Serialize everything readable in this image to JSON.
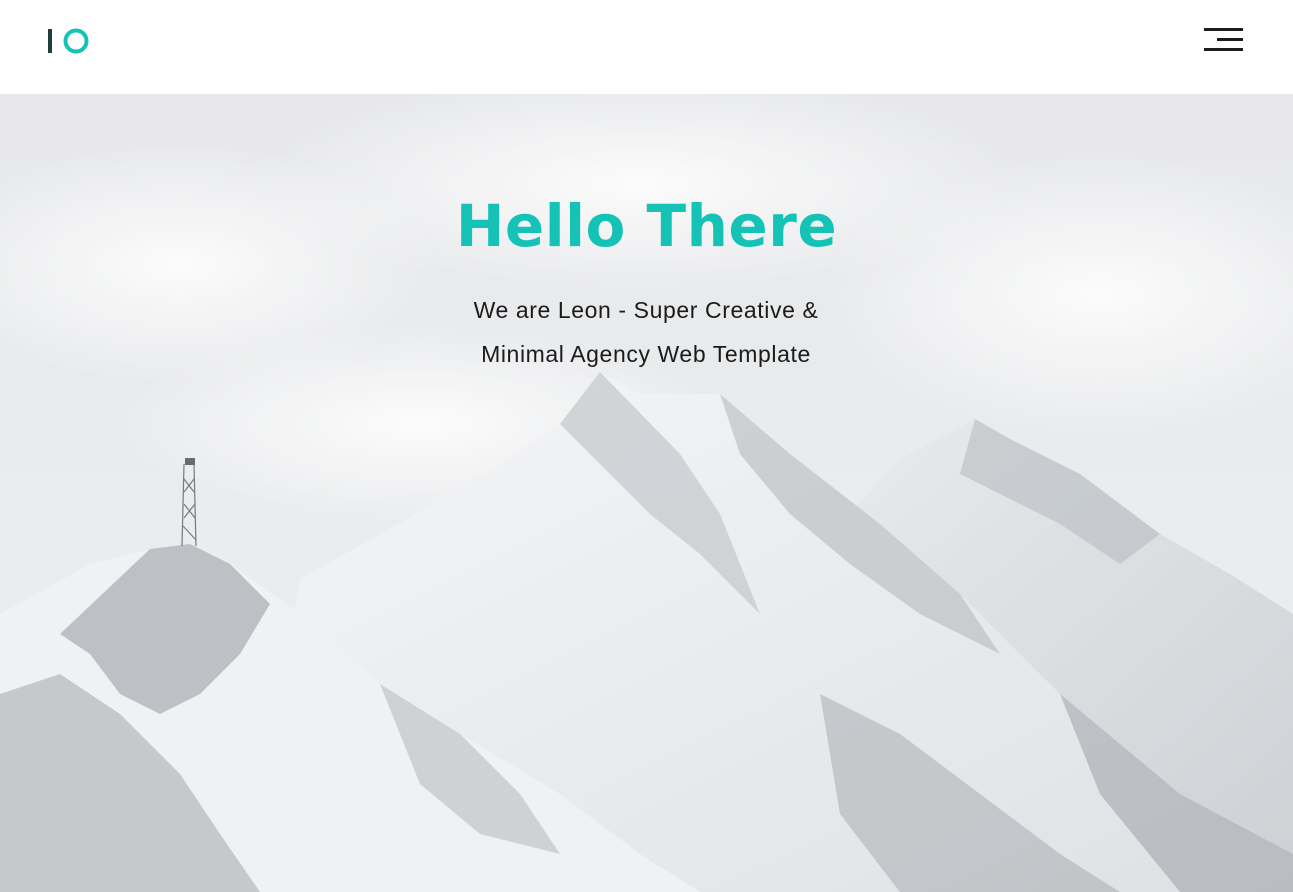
{
  "brand": {
    "logo_text": "IO",
    "accent_color": "#14c3b5",
    "logo_bar_color": "#1f3f3f"
  },
  "header": {
    "menu_icon": "hamburger-menu-icon"
  },
  "hero": {
    "title": "Hello There",
    "subtitle_line1": "We are Leon - Super Creative &",
    "subtitle_line2": "Minimal Agency Web Template",
    "background": "snowy-mountain-photo"
  }
}
